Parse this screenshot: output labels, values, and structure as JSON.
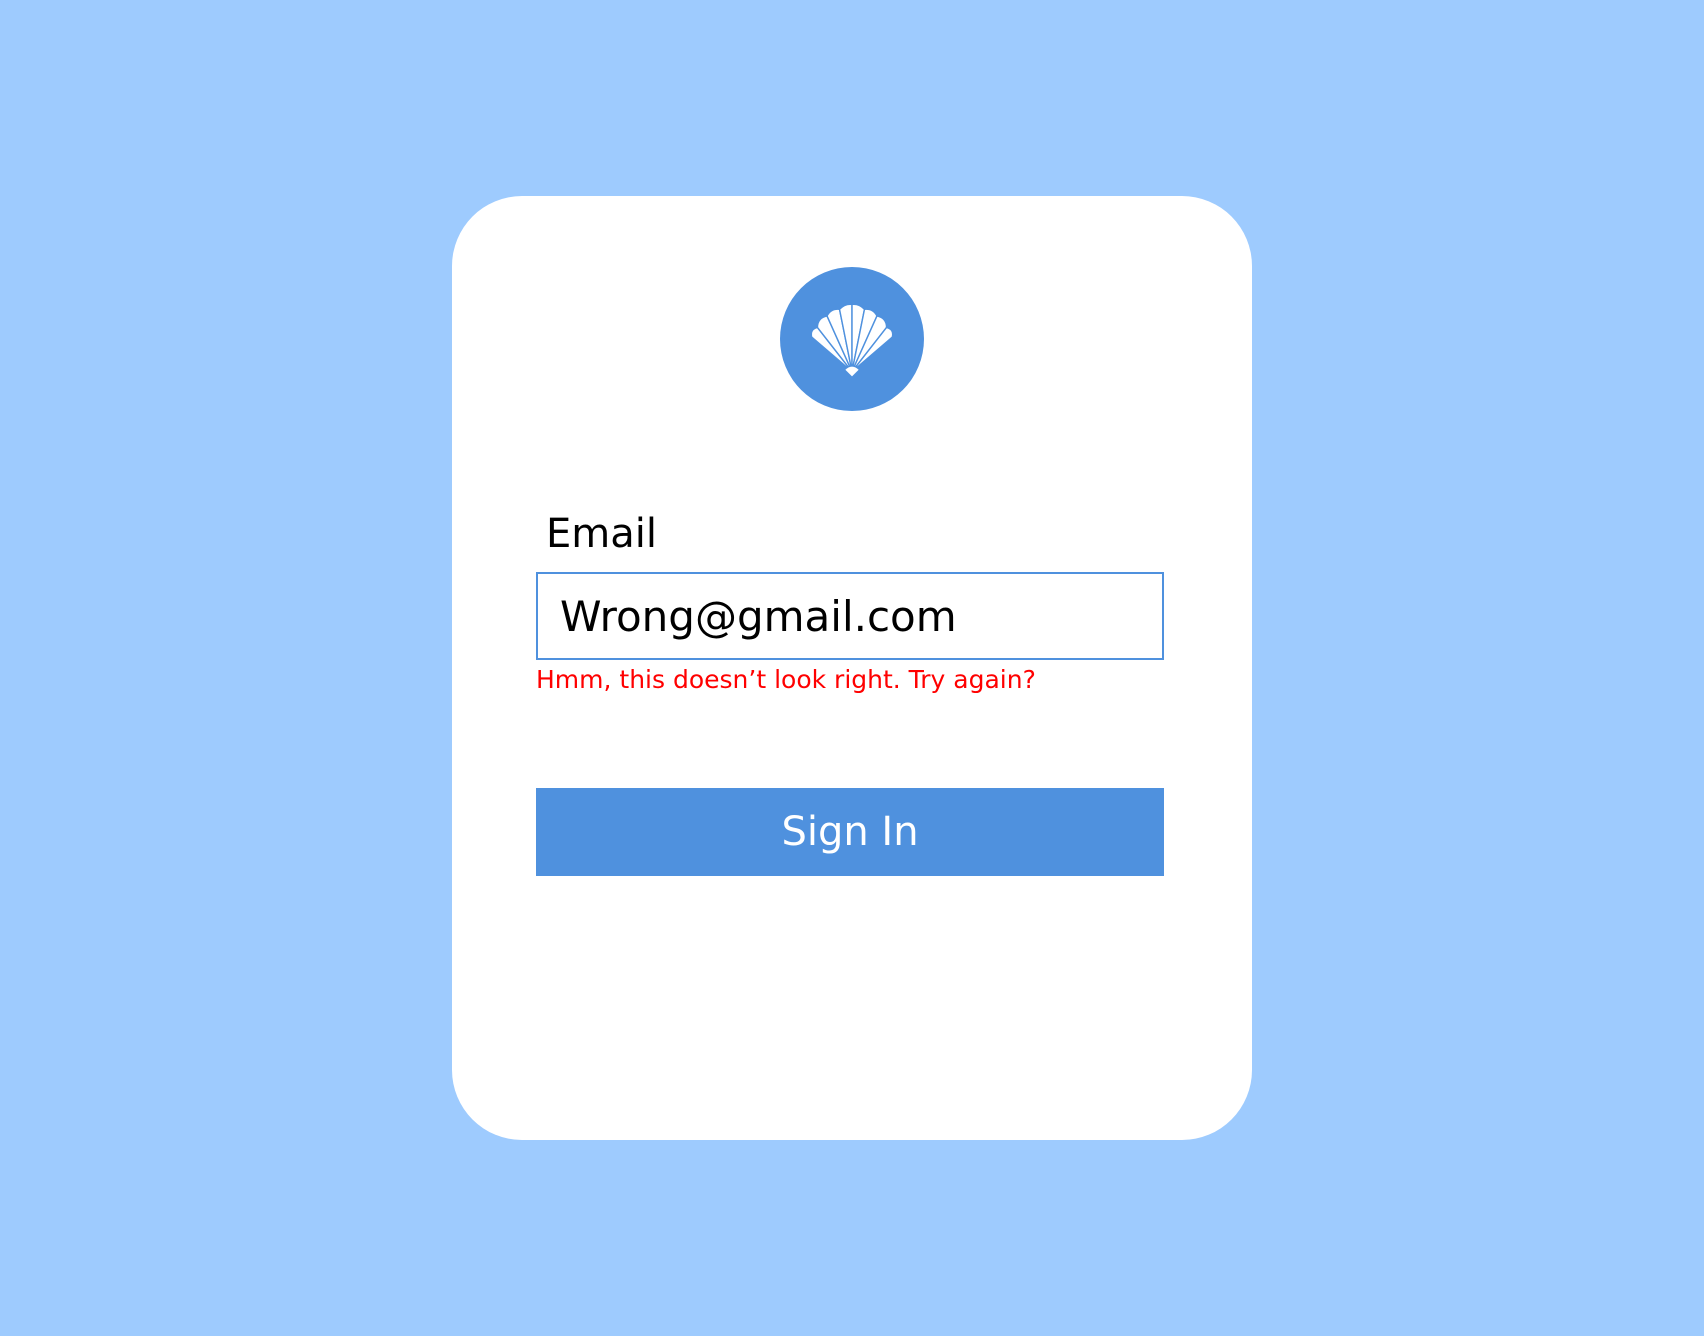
{
  "logo": {
    "icon": "seashell-icon",
    "background_color": "#4f91de"
  },
  "form": {
    "email_label": "Email",
    "email_value": "Wrong@gmail.com",
    "error_message": "Hmm, this doesn’t look right. Try again?",
    "sign_in_label": "Sign In"
  },
  "colors": {
    "page_background": "#9ecbfe",
    "accent": "#4f91de",
    "error": "#ff0000",
    "card_background": "#ffffff"
  }
}
